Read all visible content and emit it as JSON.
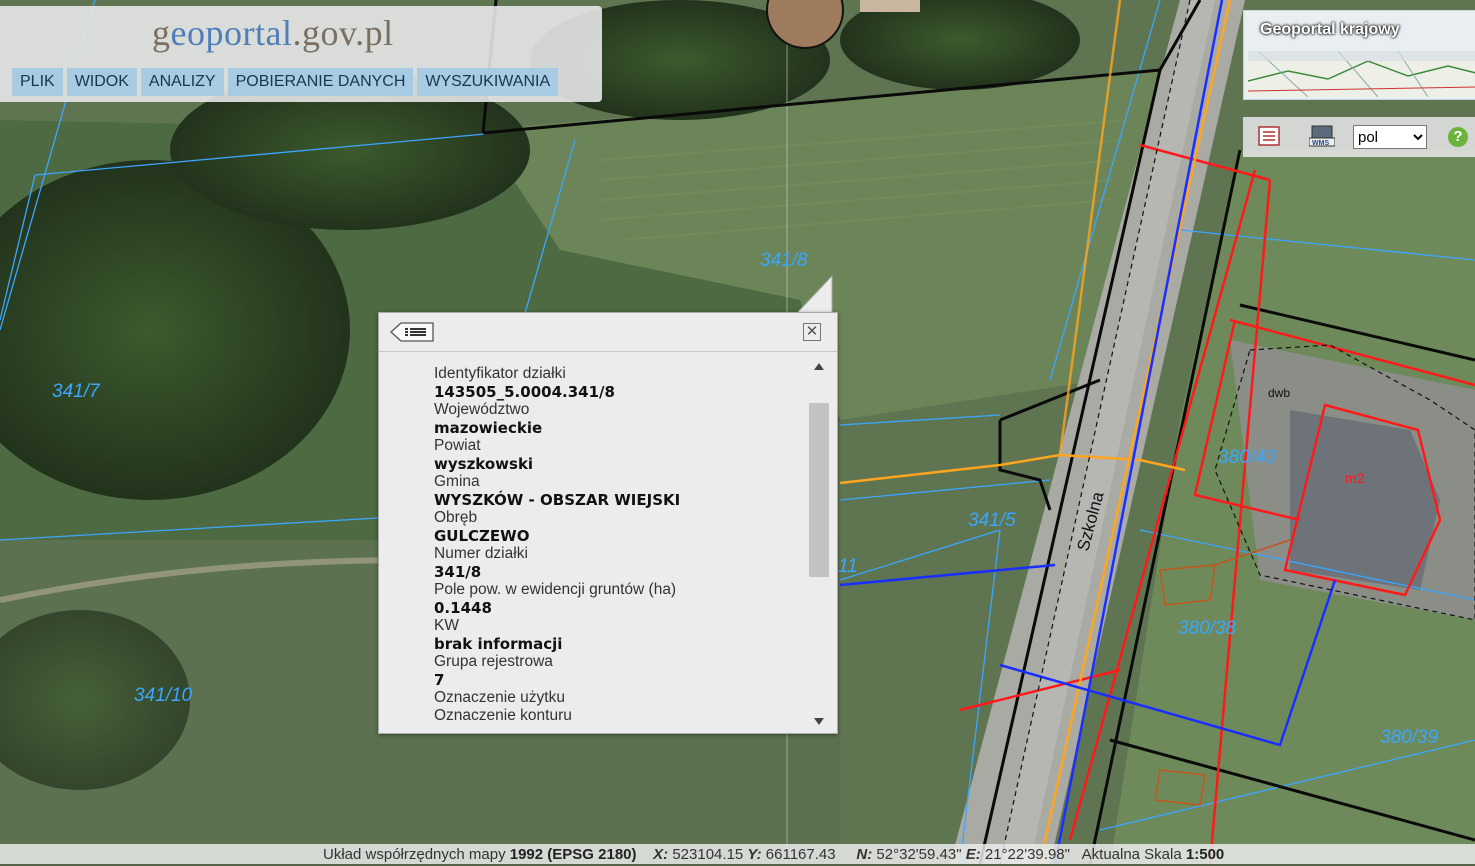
{
  "header": {
    "logo_prefix": "g",
    "logo_mid": "eoportal",
    "logo_suffix": ".gov.pl",
    "menu": [
      "PLIK",
      "WIDOK",
      "ANALIZY",
      "POBIERANIE DANYCH",
      "WYSZUKIWANIA"
    ]
  },
  "overview": {
    "title": "Geoportal krajowy"
  },
  "toolbar": {
    "language": "pol",
    "language_options": [
      "pol"
    ],
    "help": "?"
  },
  "map_labels": {
    "p1": "341/8",
    "p2": "341/7",
    "p3": "341/10",
    "p4": "341/5",
    "p5": "380/40",
    "p6": "380/38",
    "p7": "380/39",
    "p8": "11",
    "street": "Szkolna",
    "building": "m2",
    "small1": "dwb"
  },
  "popup": {
    "fields": [
      {
        "label": "Identyfikator działki",
        "value": "143505_5.0004.341/8"
      },
      {
        "label": "Województwo",
        "value": "mazowieckie"
      },
      {
        "label": "Powiat",
        "value": "wyszkowski"
      },
      {
        "label": "Gmina",
        "value": "WYSZKÓW - OBSZAR WIEJSKI"
      },
      {
        "label": "Obręb",
        "value": "GULCZEWO"
      },
      {
        "label": "Numer działki",
        "value": "341/8"
      },
      {
        "label": "Pole pow. w ewidencji gruntów (ha)",
        "value": "0.1448"
      },
      {
        "label": "KW",
        "value": "brak informacji"
      },
      {
        "label": "Grupa rejestrowa",
        "value": "7"
      },
      {
        "label": "Oznaczenie użytku",
        "value": ""
      },
      {
        "label": "Oznaczenie konturu",
        "value": ""
      }
    ]
  },
  "status": {
    "crs_label": "Układ współrzędnych mapy",
    "crs_value": "1992 (EPSG 2180)",
    "x_label": "X:",
    "x_value": "523104.15",
    "y_label": "Y:",
    "y_value": "661167.43",
    "n_label": "N:",
    "n_value": "52°32'59.43\"",
    "e_label": "E:",
    "e_value": "21°22'39.98\"",
    "scale_label": "Aktualna Skala",
    "scale_value": "1:500"
  }
}
